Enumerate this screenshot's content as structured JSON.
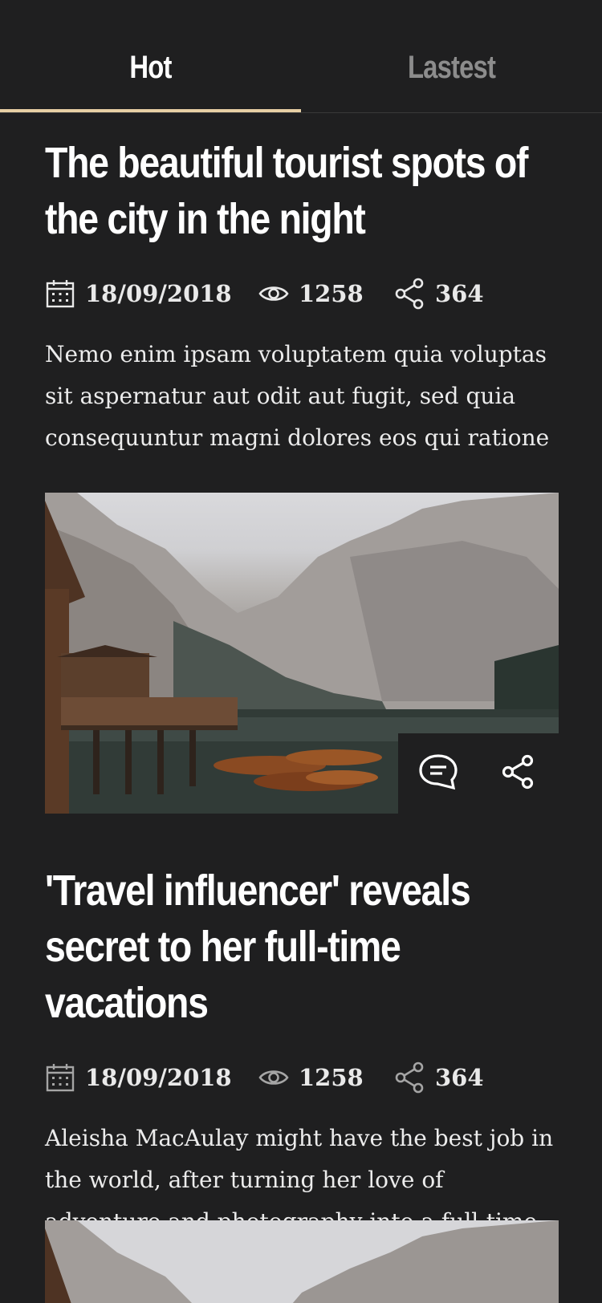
{
  "tabs": [
    {
      "label": "Hot",
      "active": true
    },
    {
      "label": "Lastest",
      "active": false
    }
  ],
  "accent_color": "#e7cfa4",
  "articles": [
    {
      "title": "The beautiful tourist spots of the city in the night",
      "date": "18/09/2018",
      "views": "1258",
      "shares": "364",
      "excerpt": "Nemo enim ipsam voluptatem quia voluptas sit aspernatur aut odit aut fugit, sed quia consequuntur magni dolores eos qui ratione",
      "actions": [
        "comment-icon",
        "share-icon"
      ]
    },
    {
      "title": "'Travel influencer' reveals secret to her full-time vacations",
      "date": "18/09/2018",
      "views": "1258",
      "shares": "364",
      "excerpt": "Aleisha MacAulay might have the best job in the world, after turning her love of adventure and photography into a full-time career."
    }
  ]
}
